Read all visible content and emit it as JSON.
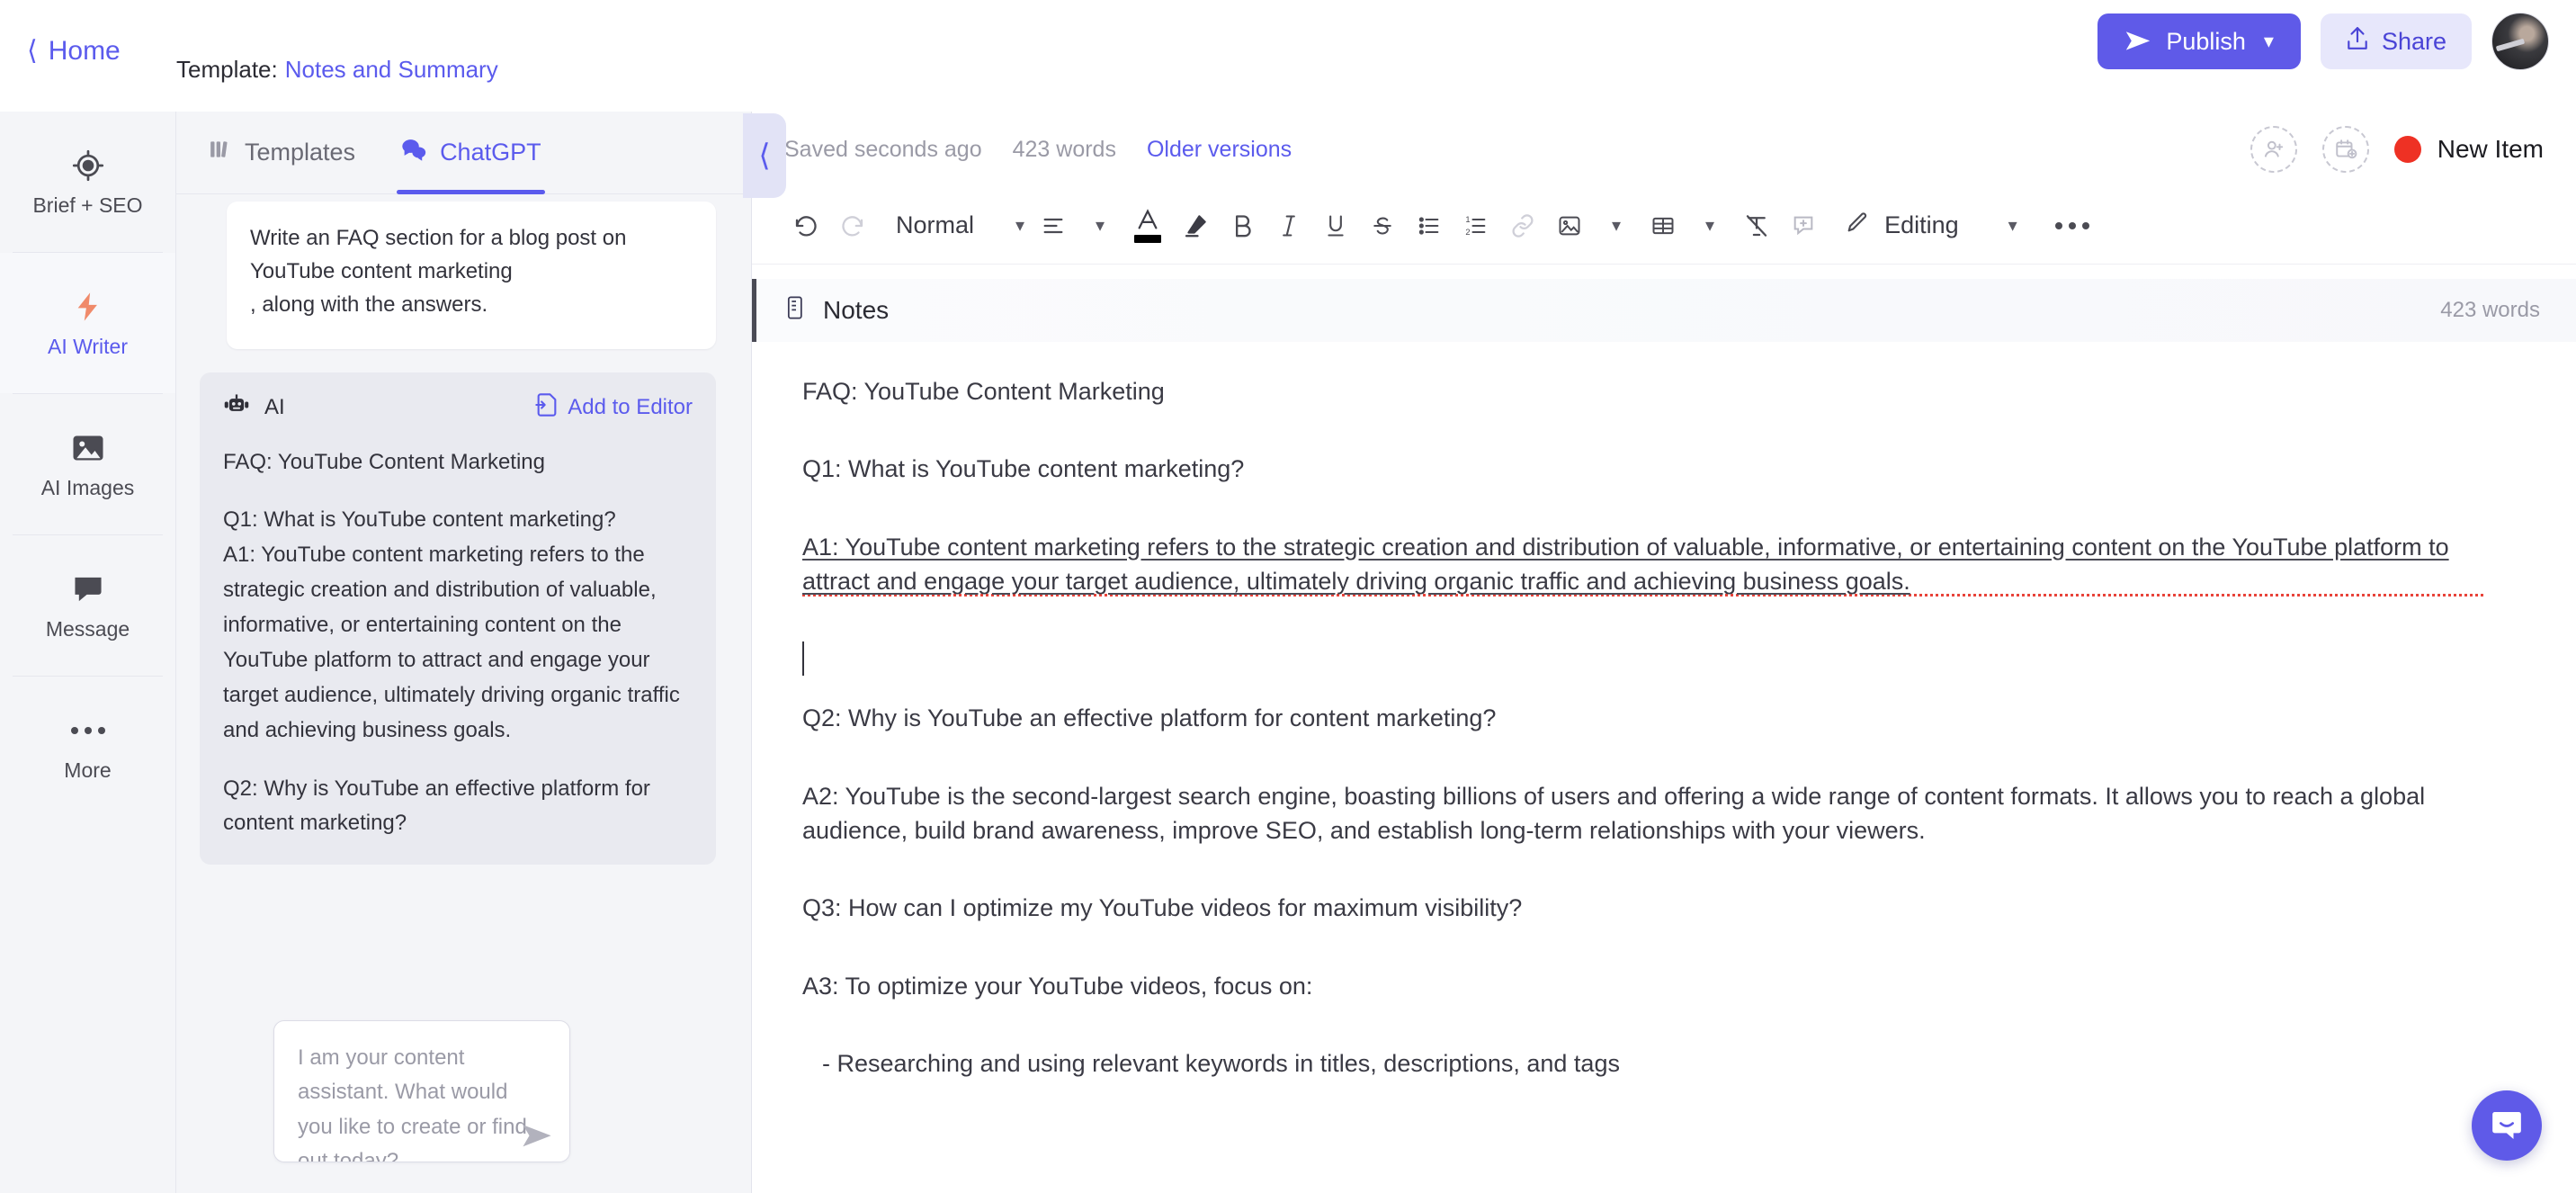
{
  "topbar": {
    "home_label": "Home",
    "home_icon": "chevron-left-icon",
    "template_label": "Template:",
    "template_value": "Notes and Summary",
    "publish_label": "Publish",
    "publish_icon": "send-icon",
    "publish_chevron": "chevron-down-icon",
    "share_label": "Share",
    "share_icon": "upload-icon",
    "avatar_icon": "user-avatar"
  },
  "colors": {
    "accent": "#5b5bed",
    "publish_bg": "#5f5ae8",
    "share_bg": "#e7e7fb",
    "status_red": "#ee3124",
    "lightning_orange": "#f08a6a",
    "panel_bg": "#f4f5f8",
    "ai_bubble_bg": "#e9eaf0"
  },
  "rail": {
    "items": [
      {
        "label": "Brief + SEO",
        "icon": "crosshair-target-icon",
        "active": false
      },
      {
        "label": "AI Writer",
        "icon": "lightning-bolt-icon",
        "active": true
      },
      {
        "label": "AI Images",
        "icon": "image-icon",
        "active": false
      },
      {
        "label": "Message",
        "icon": "speech-bubble-icon",
        "active": false
      },
      {
        "label": "More",
        "icon": "ellipsis-icon",
        "active": false
      }
    ]
  },
  "chat": {
    "tabs": [
      {
        "label": "Templates",
        "icon": "templates-icon",
        "active": false
      },
      {
        "label": "ChatGPT",
        "icon": "chat-bubbles-icon",
        "active": true
      }
    ],
    "collapse_icon": "chevron-left-icon",
    "user_message": "Write an FAQ section for a blog post on YouTube content marketing\n, along with the answers.",
    "ai_label": "AI",
    "ai_icon": "robot-icon",
    "add_to_editor_label": "Add to Editor",
    "add_to_editor_icon": "add-to-document-icon",
    "ai_paragraphs": [
      "FAQ: YouTube Content Marketing",
      "Q1: What is YouTube content marketing?\nA1: YouTube content marketing refers to the strategic creation and distribution of valuable, informative, or entertaining content on the YouTube platform to attract and engage your target audience, ultimately driving organic traffic and achieving business goals.",
      "Q2: Why is YouTube an effective platform for content marketing?"
    ],
    "input_placeholder": "I am your content assistant. What would you like to create or find out today?",
    "input_value": "",
    "send_icon": "send-icon"
  },
  "editor": {
    "status": {
      "saved_text": "Saved seconds ago",
      "word_count": "423 words",
      "older_versions": "Older versions",
      "invite_icon": "add-person-icon",
      "schedule_icon": "add-calendar-icon",
      "state_label": "New Item",
      "state_dot_color": "#ee3124"
    },
    "toolbar": {
      "undo_icon": "undo-icon",
      "redo_icon": "redo-icon",
      "style_label": "Normal",
      "style_chevron": "chevron-down-icon",
      "align_icon": "align-left-icon",
      "align_chevron": "chevron-down-icon",
      "text_color_icon": "text-color-icon",
      "highlight_icon": "highlighter-icon",
      "bold_icon": "bold-icon",
      "italic_icon": "italic-icon",
      "underline_icon": "underline-icon",
      "strikethrough_icon": "strikethrough-icon",
      "bullet_list_icon": "bullet-list-icon",
      "numbered_list_icon": "numbered-list-icon",
      "link_icon": "link-icon",
      "image_icon": "image-icon",
      "image_chevron": "chevron-down-icon",
      "table_icon": "table-icon",
      "table_chevron": "chevron-down-icon",
      "clear_format_icon": "clear-formatting-icon",
      "comment_icon": "add-comment-icon",
      "mode_icon": "pencil-icon",
      "mode_label": "Editing",
      "mode_chevron": "chevron-down-icon",
      "more_icon": "ellipsis-icon"
    },
    "notes": {
      "icon": "document-icon",
      "title": "Notes",
      "word_count": "423 words"
    },
    "document": {
      "paragraphs": [
        {
          "text": "FAQ: YouTube Content Marketing",
          "spellcheck": false
        },
        {
          "text": "Q1: What is YouTube content marketing?",
          "spellcheck": false
        },
        {
          "text": "A1: YouTube content marketing refers to the strategic creation and distribution of valuable, informative, or entertaining content on the YouTube platform to attract and engage your target audience, ultimately driving organic traffic and achieving business goals.",
          "spellcheck": true
        },
        {
          "text": "Q2: Why is YouTube an effective platform for content marketing?",
          "spellcheck": false
        },
        {
          "text": "A2: YouTube is the second-largest search engine, boasting billions of users and offering a wide range of content formats. It allows you to reach a global audience, build brand awareness, improve SEO, and establish long-term relationships with your viewers.",
          "spellcheck": false
        },
        {
          "text": "Q3: How can I optimize my YouTube videos for maximum visibility?",
          "spellcheck": false
        },
        {
          "text": "A3: To optimize your YouTube videos, focus on:",
          "spellcheck": false
        },
        {
          "text": "- Researching and using relevant keywords in titles, descriptions, and tags",
          "spellcheck": false
        }
      ]
    }
  },
  "support": {
    "icon": "intercom-chat-icon"
  }
}
